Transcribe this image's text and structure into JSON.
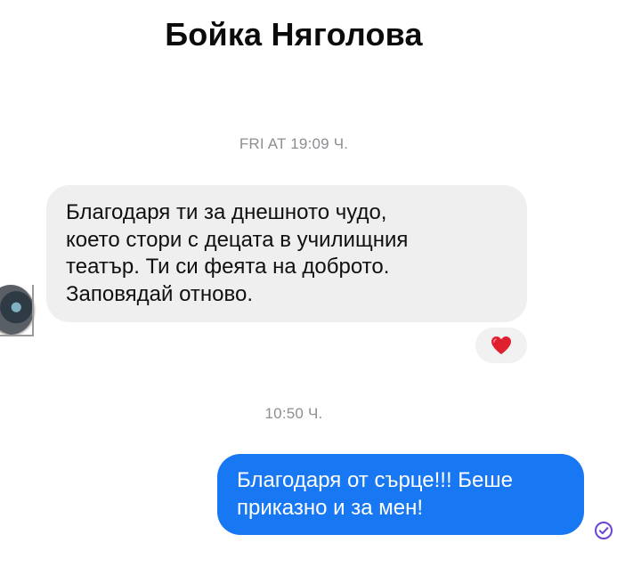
{
  "header": {
    "contact_name": "Бойка Няголова"
  },
  "conversation": {
    "timestamp_1": "FRI AT 19:09 Ч.",
    "incoming_message": {
      "lines": [
        "Благодаря ти за днешното чудо,",
        "което стори с децата в училищния",
        "театър. Ти си феята на доброто.",
        "Заповядай отново."
      ],
      "reaction_icon": "heart-emoji"
    },
    "timestamp_2": "10:50 Ч.",
    "outgoing_message": {
      "lines": [
        "Благодаря от сърце!!! Беше",
        "приказно и за мен!"
      ],
      "status_icon": "sent-check-icon"
    }
  },
  "colors": {
    "outgoing_bubble": "#1877f2",
    "incoming_bubble": "#efefef",
    "heart": "#e0202e",
    "status_icon": "#6a43d6"
  }
}
